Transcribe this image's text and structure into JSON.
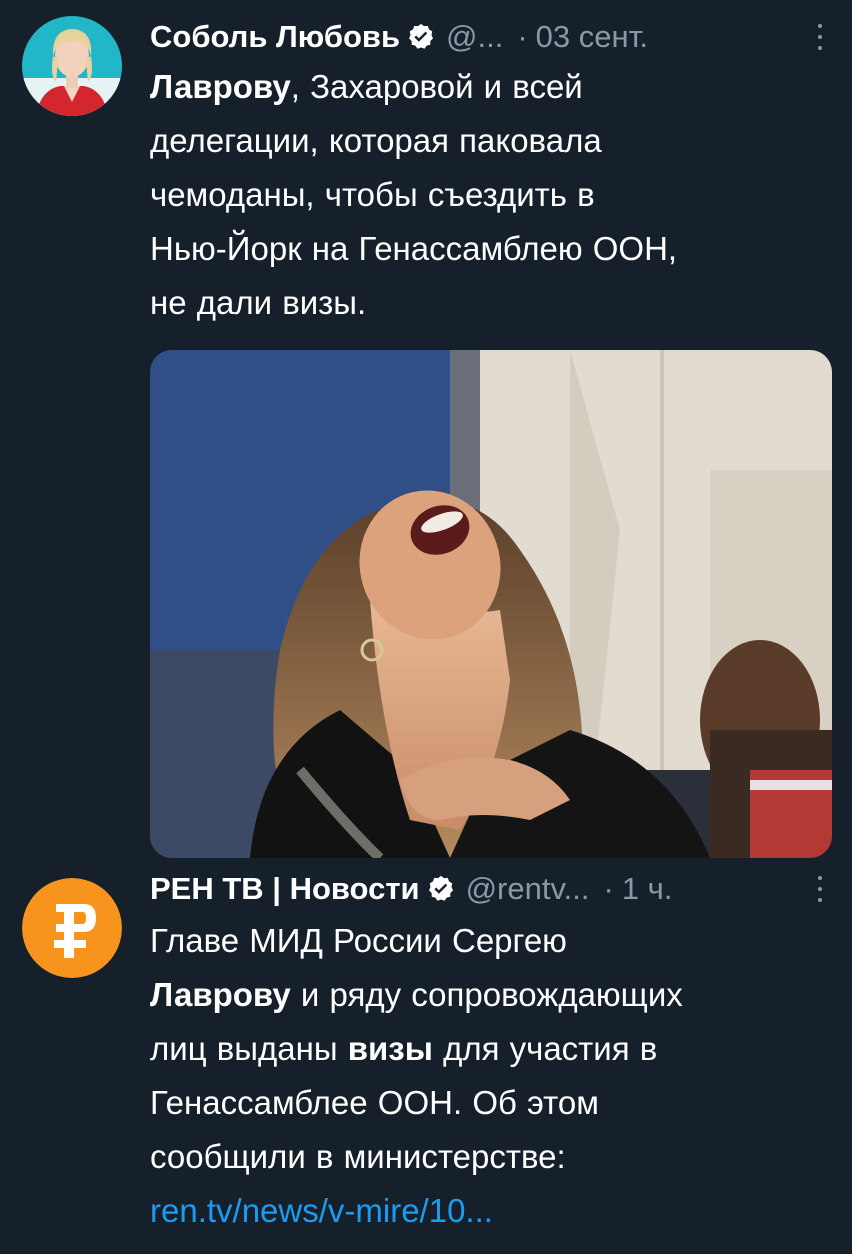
{
  "tweets": [
    {
      "author": {
        "name": "Соболь Любовь",
        "handle": "@...",
        "verified": true,
        "avatar_icon": "person-avatar"
      },
      "time": "03 сент.",
      "separator": "·",
      "text": {
        "line1_bold": "Лаврову",
        "line1_rest": ", Захаровой и всей",
        "line2": "делегации, которая паковала",
        "line3": "чемоданы, чтобы съездить в",
        "line4": "Нью-Йорк на Генассамблею ООН,",
        "line5": "не дали визы."
      },
      "media_icon": "laughing-woman-photo"
    },
    {
      "author": {
        "name": "РЕН ТВ | Новости",
        "handle": "@rentv...",
        "verified": true,
        "avatar_icon": "ren-tv-logo"
      },
      "time": "1 ч.",
      "separator": "·",
      "text": {
        "line1": "Главе МИД России Сергею",
        "line2_bold": "Лаврову",
        "line2_rest": " и ряду сопровождающих",
        "line3_a": "лиц выданы ",
        "line3_bold": "визы",
        "line3_b": " для участия в",
        "line4": "Генассамблее ООН. Об этом",
        "line5": "сообщили в министерстве:",
        "link": "ren.tv/news/v-mire/10..."
      }
    }
  ],
  "colors": {
    "background": "#15202b",
    "text": "#ffffff",
    "secondary": "#8b98a5",
    "link": "#1d9bf0",
    "verified": "#ffffff",
    "ren_orange": "#f7941d"
  }
}
